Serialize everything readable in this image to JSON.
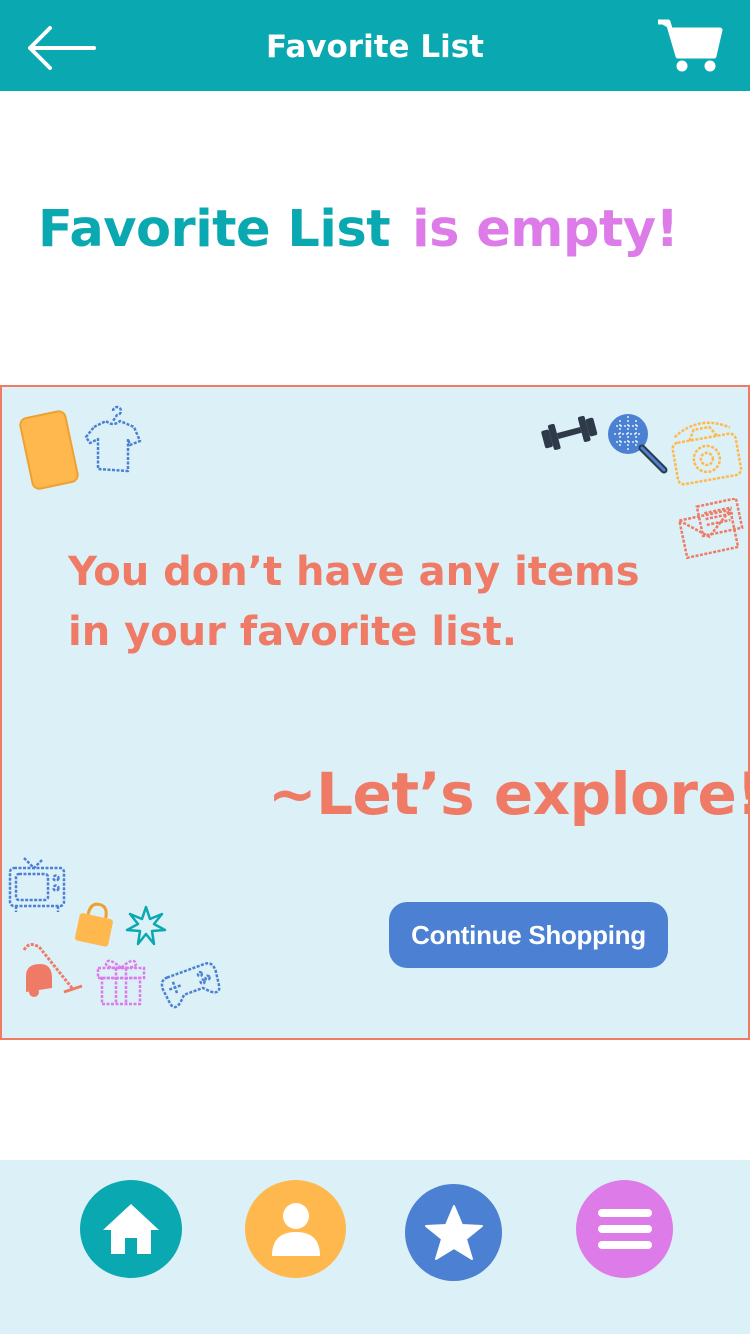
{
  "header": {
    "title": "Favorite List",
    "back_icon": "arrow-left-icon",
    "cart_icon": "shopping-cart-icon",
    "background": "#0aa8b1"
  },
  "headline": {
    "part1": "Favorite List",
    "part2": "is empty!",
    "color1": "#0aa8b1",
    "color2": "#dd7be9"
  },
  "empty_state": {
    "line1": "You don’t have any items",
    "line2": "in your favorite list.",
    "explore": "~Let’s explore!",
    "button_label": "Continue Shopping",
    "accent": "#ef7a66",
    "button_color": "#4b80d2",
    "panel_background": "#dcf1f7",
    "decor_icons": [
      "phone-icon",
      "tshirt-icon",
      "dumbbell-icon",
      "racket-icon",
      "camera-icon",
      "envelope-icon",
      "tv-icon",
      "shopping-bag-icon",
      "sparkle-icon",
      "vacuum-icon",
      "gift-icon",
      "gamepad-icon"
    ]
  },
  "bottom_nav": {
    "items": [
      {
        "name": "home",
        "icon": "home-icon",
        "color": "#0aa8b1"
      },
      {
        "name": "profile",
        "icon": "user-icon",
        "color": "#ffb84d"
      },
      {
        "name": "favorites",
        "icon": "star-icon",
        "color": "#4b80d2"
      },
      {
        "name": "menu",
        "icon": "menu-icon",
        "color": "#dd7be9"
      }
    ]
  }
}
